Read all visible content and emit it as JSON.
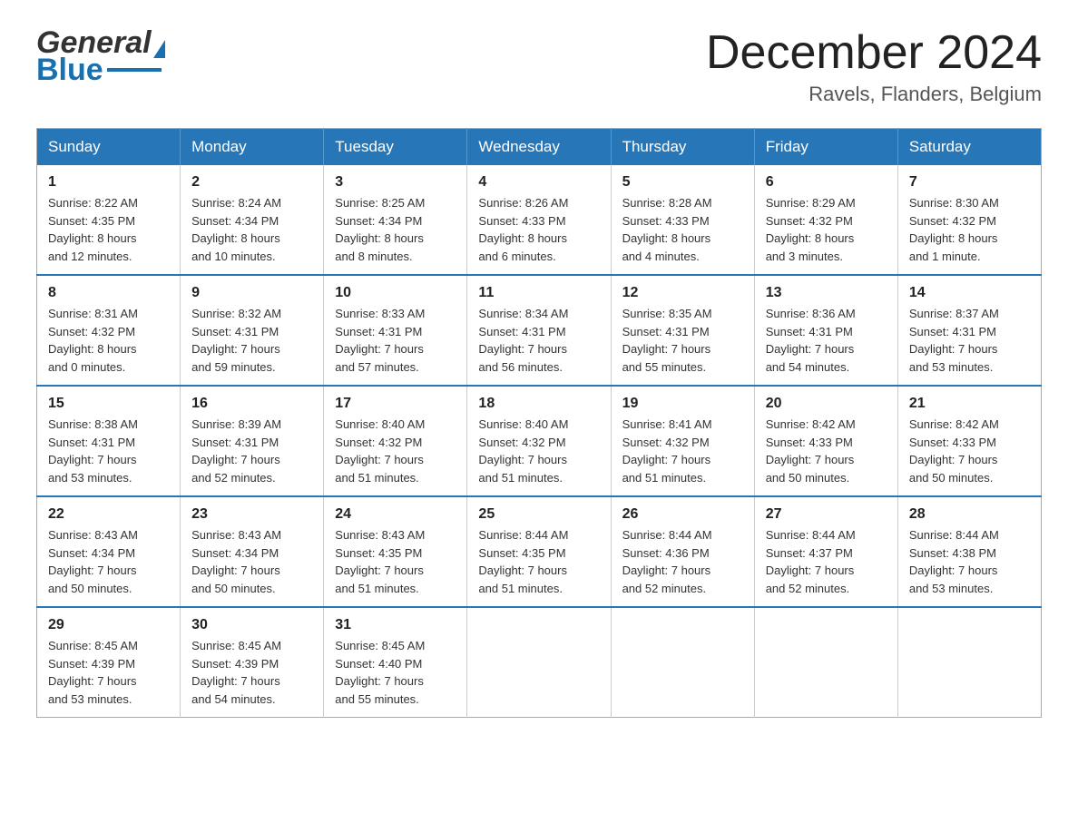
{
  "header": {
    "logo_general": "General",
    "logo_blue": "Blue",
    "month_title": "December 2024",
    "location": "Ravels, Flanders, Belgium"
  },
  "days_of_week": [
    "Sunday",
    "Monday",
    "Tuesday",
    "Wednesday",
    "Thursday",
    "Friday",
    "Saturday"
  ],
  "weeks": [
    [
      {
        "day": "1",
        "sunrise": "8:22 AM",
        "sunset": "4:35 PM",
        "daylight_hours": "8 hours",
        "daylight_minutes": "and 12 minutes."
      },
      {
        "day": "2",
        "sunrise": "8:24 AM",
        "sunset": "4:34 PM",
        "daylight_hours": "8 hours",
        "daylight_minutes": "and 10 minutes."
      },
      {
        "day": "3",
        "sunrise": "8:25 AM",
        "sunset": "4:34 PM",
        "daylight_hours": "8 hours",
        "daylight_minutes": "and 8 minutes."
      },
      {
        "day": "4",
        "sunrise": "8:26 AM",
        "sunset": "4:33 PM",
        "daylight_hours": "8 hours",
        "daylight_minutes": "and 6 minutes."
      },
      {
        "day": "5",
        "sunrise": "8:28 AM",
        "sunset": "4:33 PM",
        "daylight_hours": "8 hours",
        "daylight_minutes": "and 4 minutes."
      },
      {
        "day": "6",
        "sunrise": "8:29 AM",
        "sunset": "4:32 PM",
        "daylight_hours": "8 hours",
        "daylight_minutes": "and 3 minutes."
      },
      {
        "day": "7",
        "sunrise": "8:30 AM",
        "sunset": "4:32 PM",
        "daylight_hours": "8 hours",
        "daylight_minutes": "and 1 minute."
      }
    ],
    [
      {
        "day": "8",
        "sunrise": "8:31 AM",
        "sunset": "4:32 PM",
        "daylight_hours": "8 hours",
        "daylight_minutes": "and 0 minutes."
      },
      {
        "day": "9",
        "sunrise": "8:32 AM",
        "sunset": "4:31 PM",
        "daylight_hours": "7 hours",
        "daylight_minutes": "and 59 minutes."
      },
      {
        "day": "10",
        "sunrise": "8:33 AM",
        "sunset": "4:31 PM",
        "daylight_hours": "7 hours",
        "daylight_minutes": "and 57 minutes."
      },
      {
        "day": "11",
        "sunrise": "8:34 AM",
        "sunset": "4:31 PM",
        "daylight_hours": "7 hours",
        "daylight_minutes": "and 56 minutes."
      },
      {
        "day": "12",
        "sunrise": "8:35 AM",
        "sunset": "4:31 PM",
        "daylight_hours": "7 hours",
        "daylight_minutes": "and 55 minutes."
      },
      {
        "day": "13",
        "sunrise": "8:36 AM",
        "sunset": "4:31 PM",
        "daylight_hours": "7 hours",
        "daylight_minutes": "and 54 minutes."
      },
      {
        "day": "14",
        "sunrise": "8:37 AM",
        "sunset": "4:31 PM",
        "daylight_hours": "7 hours",
        "daylight_minutes": "and 53 minutes."
      }
    ],
    [
      {
        "day": "15",
        "sunrise": "8:38 AM",
        "sunset": "4:31 PM",
        "daylight_hours": "7 hours",
        "daylight_minutes": "and 53 minutes."
      },
      {
        "day": "16",
        "sunrise": "8:39 AM",
        "sunset": "4:31 PM",
        "daylight_hours": "7 hours",
        "daylight_minutes": "and 52 minutes."
      },
      {
        "day": "17",
        "sunrise": "8:40 AM",
        "sunset": "4:32 PM",
        "daylight_hours": "7 hours",
        "daylight_minutes": "and 51 minutes."
      },
      {
        "day": "18",
        "sunrise": "8:40 AM",
        "sunset": "4:32 PM",
        "daylight_hours": "7 hours",
        "daylight_minutes": "and 51 minutes."
      },
      {
        "day": "19",
        "sunrise": "8:41 AM",
        "sunset": "4:32 PM",
        "daylight_hours": "7 hours",
        "daylight_minutes": "and 51 minutes."
      },
      {
        "day": "20",
        "sunrise": "8:42 AM",
        "sunset": "4:33 PM",
        "daylight_hours": "7 hours",
        "daylight_minutes": "and 50 minutes."
      },
      {
        "day": "21",
        "sunrise": "8:42 AM",
        "sunset": "4:33 PM",
        "daylight_hours": "7 hours",
        "daylight_minutes": "and 50 minutes."
      }
    ],
    [
      {
        "day": "22",
        "sunrise": "8:43 AM",
        "sunset": "4:34 PM",
        "daylight_hours": "7 hours",
        "daylight_minutes": "and 50 minutes."
      },
      {
        "day": "23",
        "sunrise": "8:43 AM",
        "sunset": "4:34 PM",
        "daylight_hours": "7 hours",
        "daylight_minutes": "and 50 minutes."
      },
      {
        "day": "24",
        "sunrise": "8:43 AM",
        "sunset": "4:35 PM",
        "daylight_hours": "7 hours",
        "daylight_minutes": "and 51 minutes."
      },
      {
        "day": "25",
        "sunrise": "8:44 AM",
        "sunset": "4:35 PM",
        "daylight_hours": "7 hours",
        "daylight_minutes": "and 51 minutes."
      },
      {
        "day": "26",
        "sunrise": "8:44 AM",
        "sunset": "4:36 PM",
        "daylight_hours": "7 hours",
        "daylight_minutes": "and 52 minutes."
      },
      {
        "day": "27",
        "sunrise": "8:44 AM",
        "sunset": "4:37 PM",
        "daylight_hours": "7 hours",
        "daylight_minutes": "and 52 minutes."
      },
      {
        "day": "28",
        "sunrise": "8:44 AM",
        "sunset": "4:38 PM",
        "daylight_hours": "7 hours",
        "daylight_minutes": "and 53 minutes."
      }
    ],
    [
      {
        "day": "29",
        "sunrise": "8:45 AM",
        "sunset": "4:39 PM",
        "daylight_hours": "7 hours",
        "daylight_minutes": "and 53 minutes."
      },
      {
        "day": "30",
        "sunrise": "8:45 AM",
        "sunset": "4:39 PM",
        "daylight_hours": "7 hours",
        "daylight_minutes": "and 54 minutes."
      },
      {
        "day": "31",
        "sunrise": "8:45 AM",
        "sunset": "4:40 PM",
        "daylight_hours": "7 hours",
        "daylight_minutes": "and 55 minutes."
      },
      null,
      null,
      null,
      null
    ]
  ],
  "labels": {
    "sunrise": "Sunrise:",
    "sunset": "Sunset:",
    "daylight": "Daylight:"
  }
}
